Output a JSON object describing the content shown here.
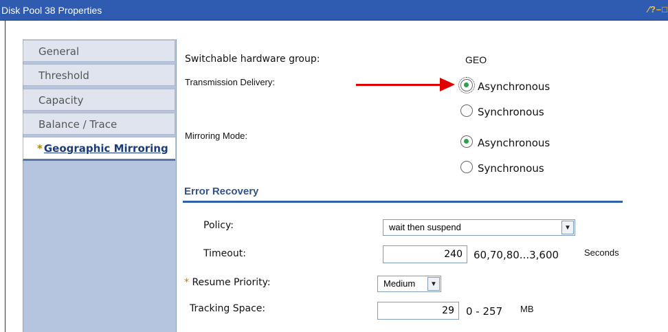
{
  "window": {
    "title": "Disk Pool 38 Properties",
    "controls": "⁄?–□"
  },
  "tabs": [
    {
      "label": "General",
      "active": false
    },
    {
      "label": "Threshold",
      "active": false
    },
    {
      "label": "Capacity",
      "active": false
    },
    {
      "label": "Balance / Trace",
      "active": false
    },
    {
      "label": "Geographic Mirroring",
      "active": true,
      "required_marker": "*"
    }
  ],
  "form": {
    "switchable_label": "Switchable hardware group:",
    "switchable_value": "GEO",
    "transmission_label": "Transmission Delivery:",
    "transmission_options": [
      "Asynchronous",
      "Synchronous"
    ],
    "transmission_selected": "Asynchronous",
    "mirroring_label": "Mirroring Mode:",
    "mirroring_options": [
      "Asynchronous",
      "Synchronous"
    ],
    "mirroring_selected": "Asynchronous"
  },
  "error_recovery": {
    "title": "Error Recovery",
    "policy_label": "Policy:",
    "policy_value": "wait then suspend",
    "timeout_label": "Timeout:",
    "timeout_value": "240",
    "timeout_range": "60,70,80...3,600",
    "timeout_unit": "Seconds",
    "resume_marker": "*",
    "resume_label": "Resume Priority:",
    "resume_value": "Medium",
    "tracking_label": "Tracking Space:",
    "tracking_value": "29",
    "tracking_range": "0 - 257",
    "tracking_unit": "MB"
  },
  "colors": {
    "titlebar": "#2f5bb0",
    "sidebar": "#b6c5df",
    "accent": "#2f5fa8",
    "arrow": "#e00000",
    "radio_on": "#2aa24a"
  }
}
